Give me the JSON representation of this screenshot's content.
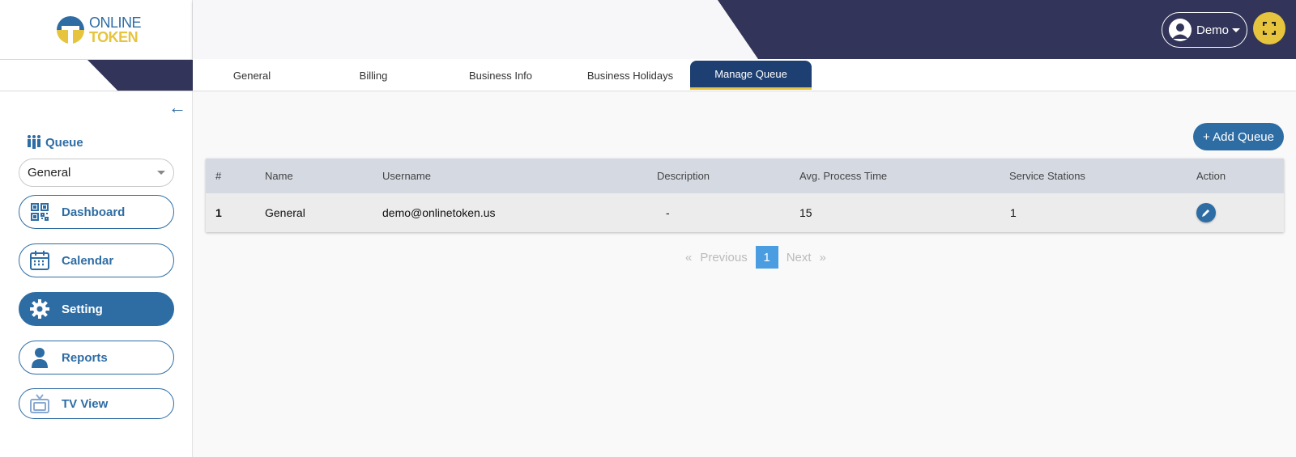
{
  "logo": {
    "line1": "ONLINE",
    "line2": "TOKEN"
  },
  "sidebar": {
    "queue_label": "Queue",
    "queue_select": "General",
    "items": [
      {
        "label": "Dashboard",
        "icon": "qr-code-icon"
      },
      {
        "label": "Calendar",
        "icon": "calendar-icon"
      },
      {
        "label": "Setting",
        "icon": "gear-icon",
        "active": true
      },
      {
        "label": "Reports",
        "icon": "user-icon"
      },
      {
        "label": "TV View",
        "icon": "tv-icon"
      }
    ]
  },
  "header": {
    "user_name": "Demo"
  },
  "tabs": [
    {
      "label": "General"
    },
    {
      "label": "Billing"
    },
    {
      "label": "Business Info"
    },
    {
      "label": "Business Holidays"
    },
    {
      "label": "Manage Queue",
      "active": true
    }
  ],
  "main": {
    "add_button": "+ Add Queue",
    "table": {
      "columns": [
        "#",
        "Name",
        "Username",
        "Description",
        "Avg. Process Time",
        "Service Stations",
        "Action"
      ],
      "rows": [
        {
          "num": "1",
          "name": "General",
          "username": "demo@onlinetoken.us",
          "description": "-",
          "avg_time": "15",
          "stations": "1"
        }
      ]
    },
    "pagination": {
      "first": "«",
      "prev": "Previous",
      "page": "1",
      "next": "Next",
      "last": "»"
    }
  },
  "colors": {
    "navy": "#323559",
    "primary": "#2e6da4",
    "accent": "#e6c43e",
    "tab_active": "#1d3f72"
  }
}
